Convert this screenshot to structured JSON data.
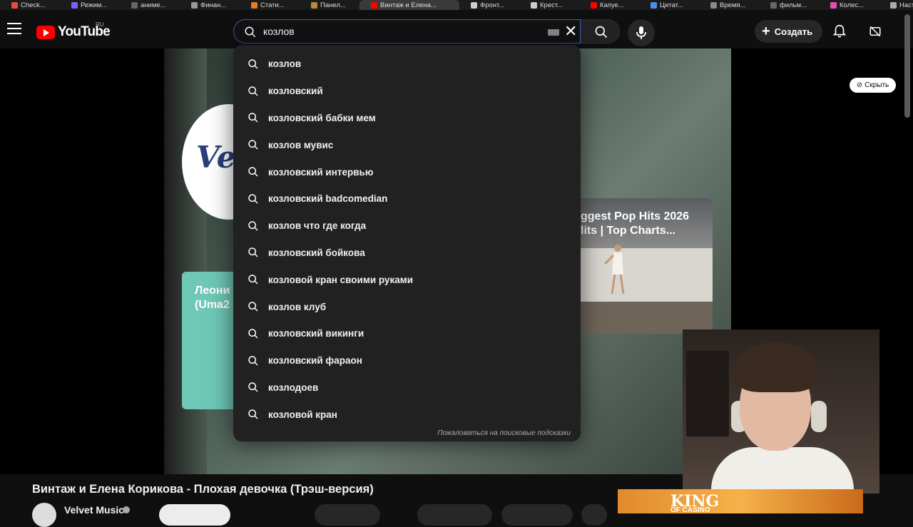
{
  "browser_tabs": [
    {
      "label": "Check...",
      "color": "#e84c3d"
    },
    {
      "label": "Режим...",
      "color": "#7b61ff"
    },
    {
      "label": "аниме...",
      "color": "#666666"
    },
    {
      "label": "Финан...",
      "color": "#999999"
    },
    {
      "label": "Стати...",
      "color": "#e07b2a"
    },
    {
      "label": "Панел...",
      "color": "#b58a3c"
    },
    {
      "label": "Винтаж и Елена...",
      "color": "#ff0000"
    },
    {
      "label": "Фронт...",
      "color": "#cccccc"
    },
    {
      "label": "Крест...",
      "color": "#cccccc"
    },
    {
      "label": "Капуе...",
      "color": "#ff0000"
    },
    {
      "label": "Цитат...",
      "color": "#4a90e2"
    },
    {
      "label": "Время...",
      "color": "#888888"
    },
    {
      "label": "фильм...",
      "color": "#666666"
    },
    {
      "label": "Колес...",
      "color": "#e84cbb"
    },
    {
      "label": "Насто...",
      "color": "#aaaaaa"
    }
  ],
  "header": {
    "logo_text": "YouTube",
    "region": "RU",
    "search_value": "козлов",
    "create_label": "Создать"
  },
  "suggestions": [
    "козлов",
    "козловский",
    "козловский бабки мем",
    "козлов мувис",
    "козловский интервью",
    "козловский badcomedian",
    "козлов что где когда",
    "козловский бойкова",
    "козловой кран своими руками",
    "козлов клуб",
    "козловский викинги",
    "козловский фараон",
    "козлодоев",
    "козловой кран"
  ],
  "report_link": "Пожаловаться на поисковые подсказки",
  "video": {
    "title": "Винтаж и Елена Корикова - Плохая девочка (Трэш-версия)",
    "channel": "Velvet Music",
    "badge_text": "Velvet",
    "card_left_title": "Леони\n(Uma2",
    "card_right_title": "ggest Pop Hits 2026\nlits | Top Charts...",
    "hide_label": "Скрыть"
  },
  "ad": {
    "title": "KING",
    "subtitle": "OF CASINO"
  },
  "colors": {
    "brand_red": "#ff0000",
    "focus_border": "#3a5ab8",
    "dropdown_bg": "#212121",
    "page_bg": "#0f0f0f"
  }
}
